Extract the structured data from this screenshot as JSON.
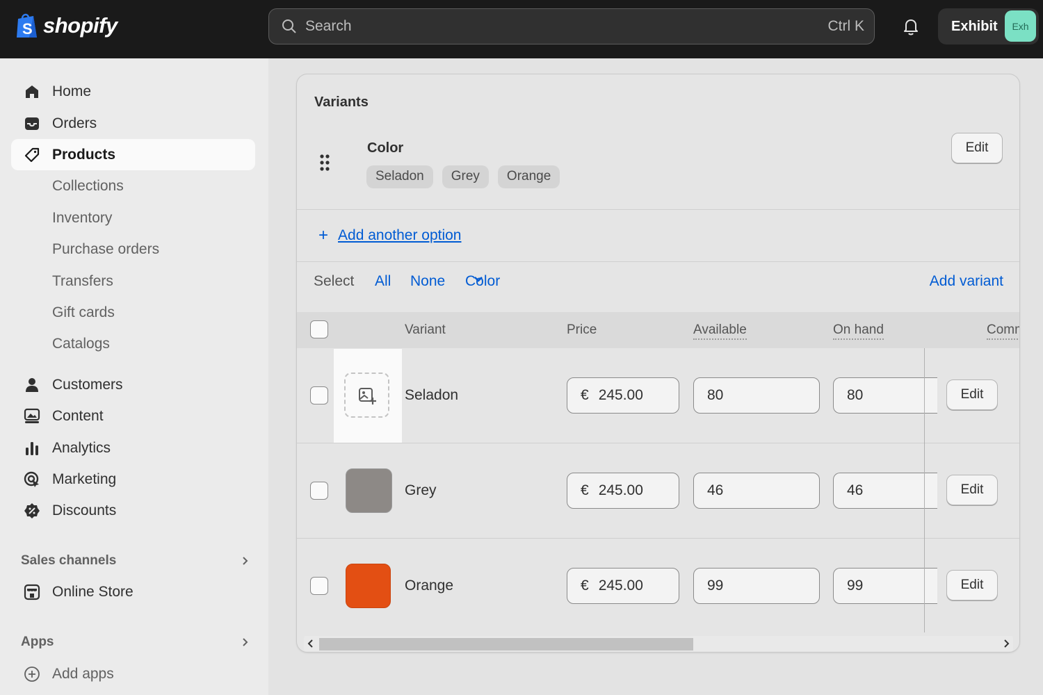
{
  "topbar": {
    "brand": "shopify",
    "brand_bag_letter": "S",
    "search_placeholder": "Search",
    "search_shortcut": "Ctrl K",
    "store_name": "Exhibit",
    "avatar_text": "Exh"
  },
  "sidebar": {
    "main_items": [
      {
        "label": "Home",
        "icon": "home-icon"
      },
      {
        "label": "Orders",
        "icon": "inbox-icon"
      },
      {
        "label": "Products",
        "icon": "tag-icon",
        "active": true
      }
    ],
    "product_sub_items": [
      "Collections",
      "Inventory",
      "Purchase orders",
      "Transfers",
      "Gift cards",
      "Catalogs"
    ],
    "other_items": [
      {
        "label": "Customers",
        "icon": "person-icon"
      },
      {
        "label": "Content",
        "icon": "content-icon"
      },
      {
        "label": "Analytics",
        "icon": "bar-chart-icon"
      },
      {
        "label": "Marketing",
        "icon": "target-icon"
      },
      {
        "label": "Discounts",
        "icon": "discount-badge-icon"
      }
    ],
    "sales_channels_header": "Sales channels",
    "online_store": "Online Store",
    "apps_header": "Apps",
    "add_apps": "Add apps"
  },
  "variants_card": {
    "title": "Variants",
    "option_name": "Color",
    "option_values": [
      "Seladon",
      "Grey",
      "Orange"
    ],
    "edit_option_label": "Edit",
    "add_option_plus": "+",
    "add_option_label": "Add another option",
    "select_label": "Select",
    "select_all": "All",
    "select_none": "None",
    "select_color": "Color",
    "add_variant": "Add variant",
    "columns": {
      "variant": "Variant",
      "price": "Price",
      "available": "Available",
      "on_hand": "On hand",
      "committed": "Comm"
    },
    "rows": [
      {
        "name": "Seladon",
        "currency": "€",
        "price": "245.00",
        "available": "80",
        "on_hand": "80",
        "edit": "Edit",
        "swatch": null
      },
      {
        "name": "Grey",
        "currency": "€",
        "price": "245.00",
        "available": "46",
        "on_hand": "46",
        "edit": "Edit",
        "swatch": "#8d8986"
      },
      {
        "name": "Orange",
        "currency": "€",
        "price": "245.00",
        "available": "99",
        "on_hand": "99",
        "edit": "Edit",
        "swatch": "#e34f13"
      }
    ]
  },
  "colors": {
    "accent_link": "#005bd3",
    "topbar_bg": "#1a1a1a",
    "avatar_bg": "#7be0c4"
  }
}
